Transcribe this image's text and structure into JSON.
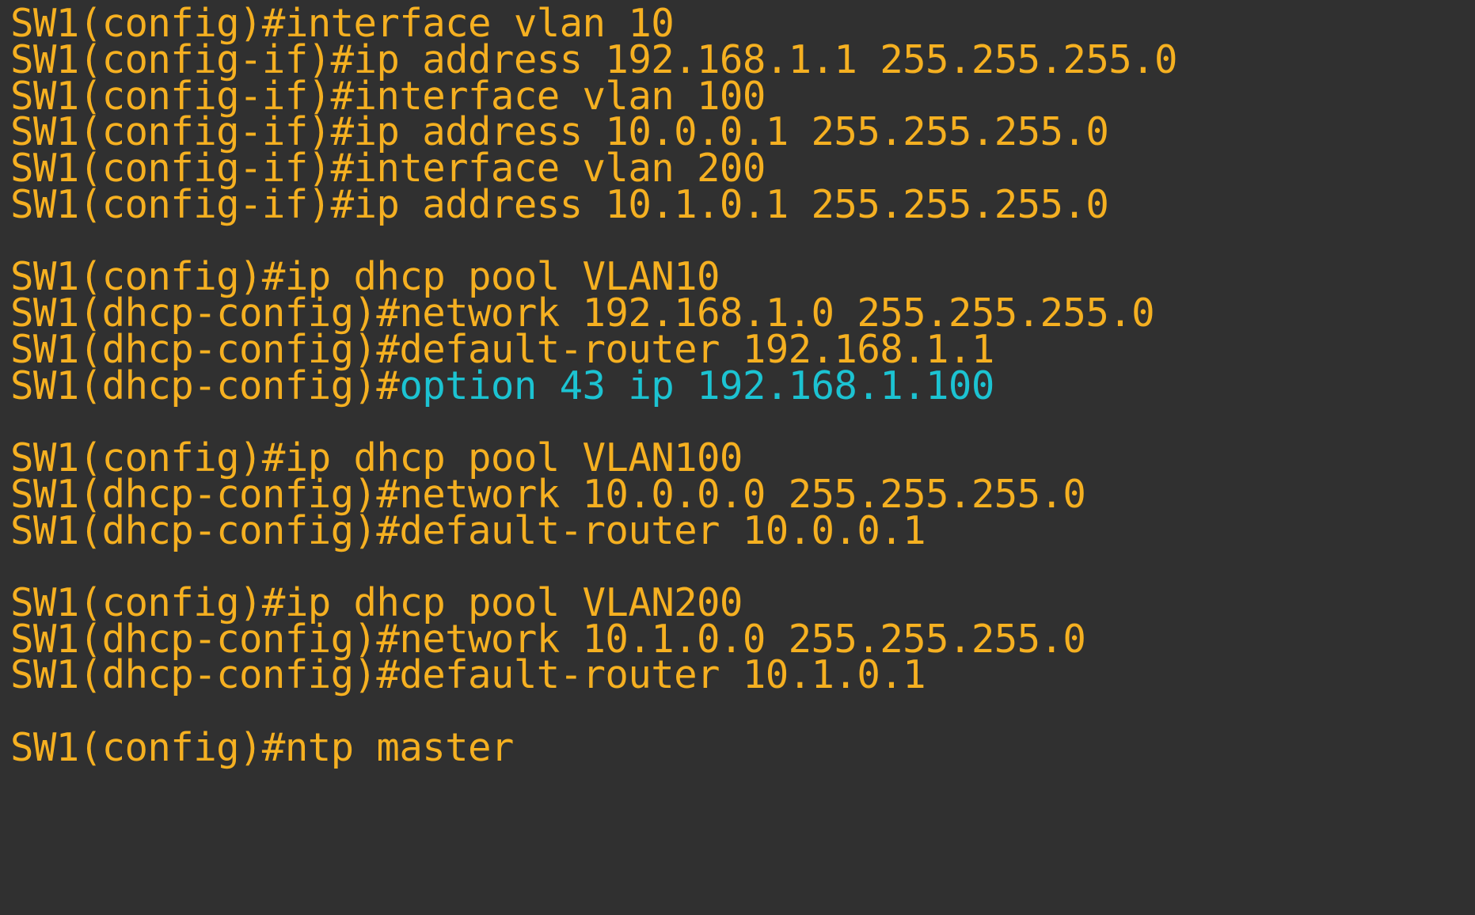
{
  "colors": {
    "background": "#303030",
    "command_text": "#f5b021",
    "highlight_text": "#1cc3d2"
  },
  "lines": [
    {
      "prompt": "SW1(config)#",
      "command": "interface vlan 10"
    },
    {
      "prompt": "SW1(config-if)#",
      "command": "ip address 192.168.1.1 255.255.255.0"
    },
    {
      "prompt": "SW1(config-if)#",
      "command": "interface vlan 100"
    },
    {
      "prompt": "SW1(config-if)#",
      "command": "ip address 10.0.0.1 255.255.255.0"
    },
    {
      "prompt": "SW1(config-if)#",
      "command": "interface vlan 200"
    },
    {
      "prompt": "SW1(config-if)#",
      "command": "ip address 10.1.0.1 255.255.255.0"
    },
    {
      "prompt": "SW1(config)#",
      "command": "ip dhcp pool VLAN10"
    },
    {
      "prompt": "SW1(dhcp-config)#",
      "command": "network 192.168.1.0 255.255.255.0"
    },
    {
      "prompt": "SW1(dhcp-config)#",
      "command": "default-router 192.168.1.1"
    },
    {
      "prompt": "SW1(dhcp-config)#",
      "command": "option 43 ip 192.168.1.100",
      "highlight": true
    },
    {
      "prompt": "SW1(config)#",
      "command": "ip dhcp pool VLAN100"
    },
    {
      "prompt": "SW1(dhcp-config)#",
      "command": "network 10.0.0.0 255.255.255.0"
    },
    {
      "prompt": "SW1(dhcp-config)#",
      "command": "default-router 10.0.0.1"
    },
    {
      "prompt": "SW1(config)#",
      "command": "ip dhcp pool VLAN200"
    },
    {
      "prompt": "SW1(dhcp-config)#",
      "command": "network 10.1.0.0 255.255.255.0"
    },
    {
      "prompt": "SW1(dhcp-config)#",
      "command": "default-router 10.1.0.1"
    },
    {
      "prompt": "SW1(config)#",
      "command": "ntp master"
    }
  ]
}
